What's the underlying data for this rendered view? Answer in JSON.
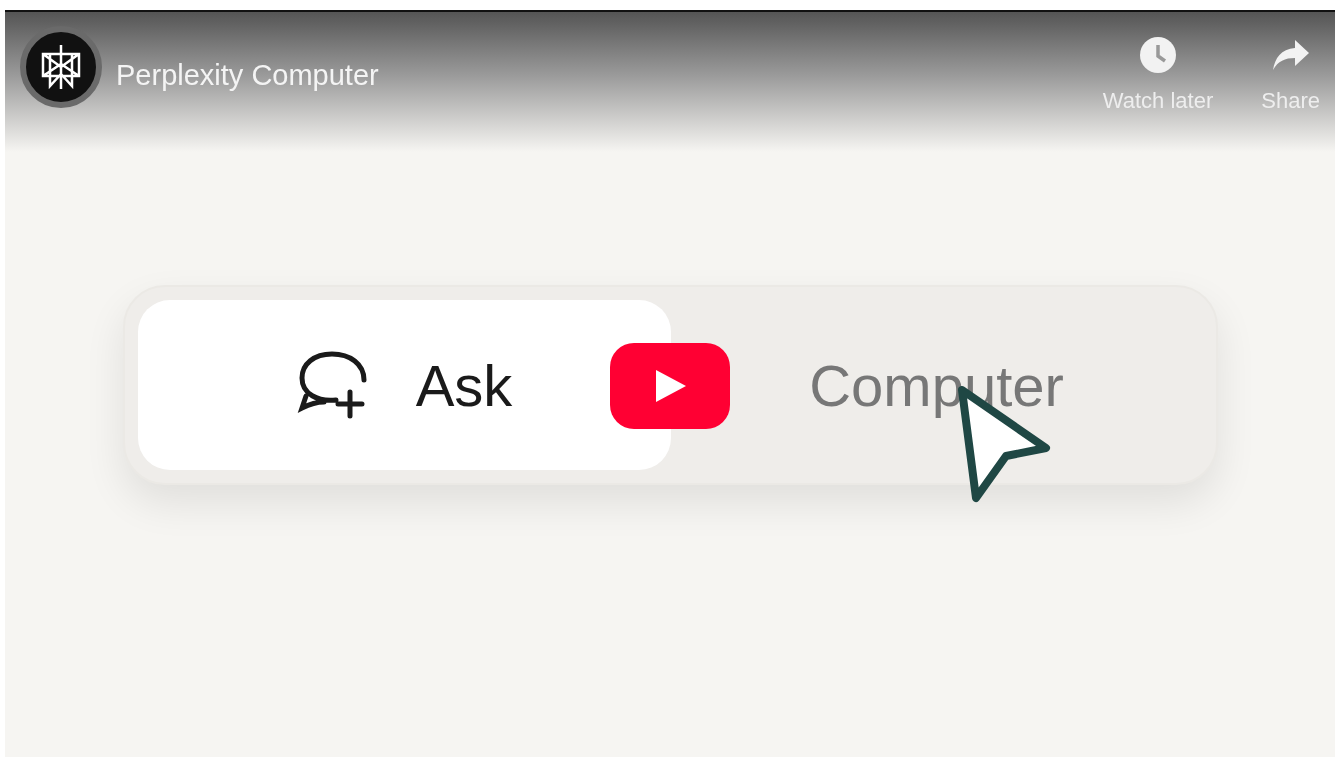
{
  "video": {
    "title": "Perplexity Computer",
    "actions": [
      {
        "kind": "watch-later",
        "label": "Watch later"
      },
      {
        "kind": "share",
        "label": "Share"
      }
    ]
  },
  "toggle": {
    "segments": [
      {
        "kind": "ask",
        "label": "Ask",
        "selected": true
      },
      {
        "kind": "computer",
        "label": "Computer",
        "selected": false
      }
    ]
  }
}
